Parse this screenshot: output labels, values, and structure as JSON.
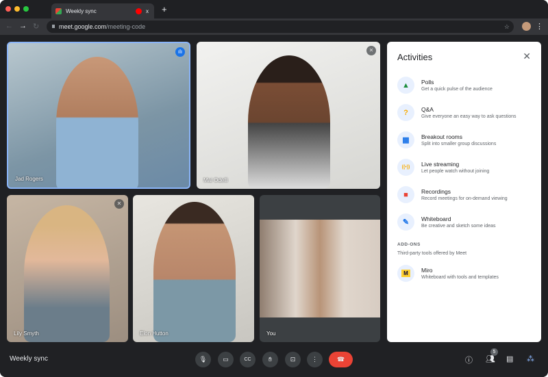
{
  "browser": {
    "tab_title": "Weekly sync",
    "url_host": "meet.google.com",
    "url_path": "/meeting-code",
    "new_tab": "+",
    "close_tab": "x"
  },
  "participants": [
    {
      "name": "Jad Rogers",
      "speaking": true
    },
    {
      "name": "Mai Odelli",
      "muted": true
    },
    {
      "name": "Lily Smyth",
      "muted": true
    },
    {
      "name": "Elon Hutton"
    },
    {
      "name": "You"
    }
  ],
  "activities": {
    "title": "Activities",
    "items": [
      {
        "title": "Polls",
        "subtitle": "Get a quick pulse of the audience",
        "icon": "polls-icon",
        "glyph": "▲",
        "color": "#1e8e3e"
      },
      {
        "title": "Q&A",
        "subtitle": "Give everyone an easy way to ask questions",
        "icon": "question-icon",
        "glyph": "?",
        "color": "#f9ab00"
      },
      {
        "title": "Breakout rooms",
        "subtitle": "Split into smaller group discussions",
        "icon": "breakout-icon",
        "glyph": "▦",
        "color": "#1a73e8"
      },
      {
        "title": "Live streaming",
        "subtitle": "Let people watch without joining",
        "icon": "streaming-icon",
        "glyph": "((•))",
        "color": "#f9ab00"
      },
      {
        "title": "Recordings",
        "subtitle": "Record meetings for on-demand viewing",
        "icon": "recording-icon",
        "glyph": "■",
        "color": "#ea4335"
      }
    ],
    "whiteboard": {
      "title": "Whiteboard",
      "subtitle": "Be creative and sketch some ideas",
      "glyph": "✎",
      "color": "#1a73e8"
    },
    "addons_heading": "ADD-ONS",
    "addons_sub": "Third-party tools offered by Meet",
    "miro": {
      "title": "Miro",
      "subtitle": "Whiteboard with tools and templates",
      "glyph": "M",
      "color": "#ffd02f"
    }
  },
  "bottom": {
    "meeting_title": "Weekly sync",
    "participant_count": "5"
  }
}
